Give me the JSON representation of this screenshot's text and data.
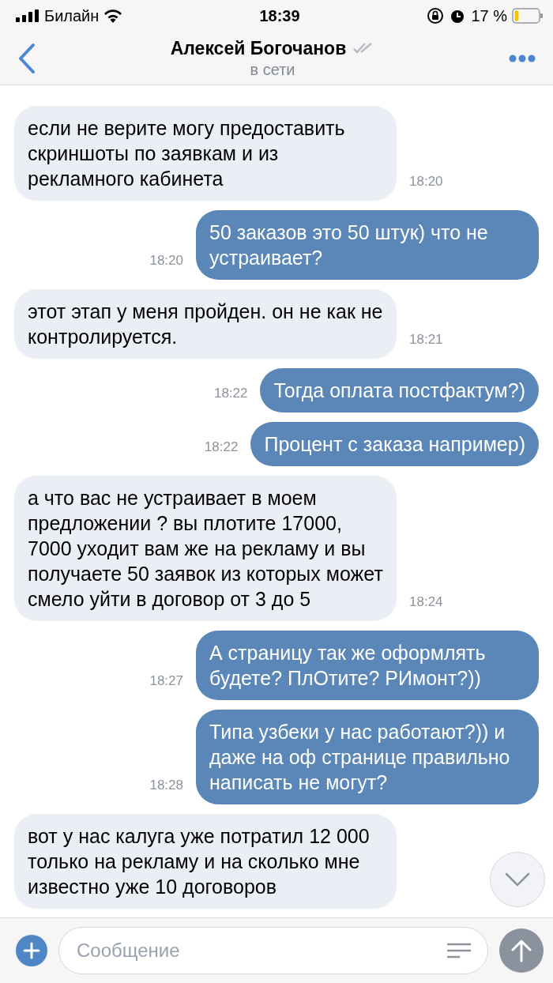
{
  "status_bar": {
    "carrier": "Билайн",
    "time": "18:39",
    "battery_text": "17 %"
  },
  "header": {
    "title": "Алексей Богочанов",
    "subtitle": "в сети"
  },
  "messages": [
    {
      "kind": "incoming",
      "text": "если не верите могу предоставить скриншоты по заявкам и из рекламного кабинета",
      "time": "18:20"
    },
    {
      "kind": "outgoing",
      "text": "50 заказов это 50 штук) что не устраивает?",
      "time": "18:20"
    },
    {
      "kind": "incoming",
      "text": "этот этап у меня пройден. он не как не контролируется.",
      "time": "18:21"
    },
    {
      "kind": "outgoing",
      "text": "Тогда оплата постфактум?)",
      "time": "18:22"
    },
    {
      "kind": "outgoing",
      "text": "Процент с заказа например)",
      "time": "18:22"
    },
    {
      "kind": "incoming",
      "text": "а что вас не устраивает в моем предложении ? вы плотите 17000, 7000 уходит вам же на рекламу и вы получаете 50 заявок из которых может смело уйти в договор от 3 до 5",
      "time": "18:24"
    },
    {
      "kind": "outgoing",
      "text": "А страницу так же оформлять будете? ПлОтите? РИмонт?))",
      "time": "18:27"
    },
    {
      "kind": "outgoing",
      "text": "Типа узбеки у нас работают?)) и даже на оф странице правильно написать не могут?",
      "time": "18:28"
    },
    {
      "kind": "incoming",
      "text": "вот у нас калуга уже потратил 12 000 только на рекламу и на сколько мне известно уже 10 договоров"
    }
  ],
  "composer": {
    "placeholder": "Сообщение"
  }
}
